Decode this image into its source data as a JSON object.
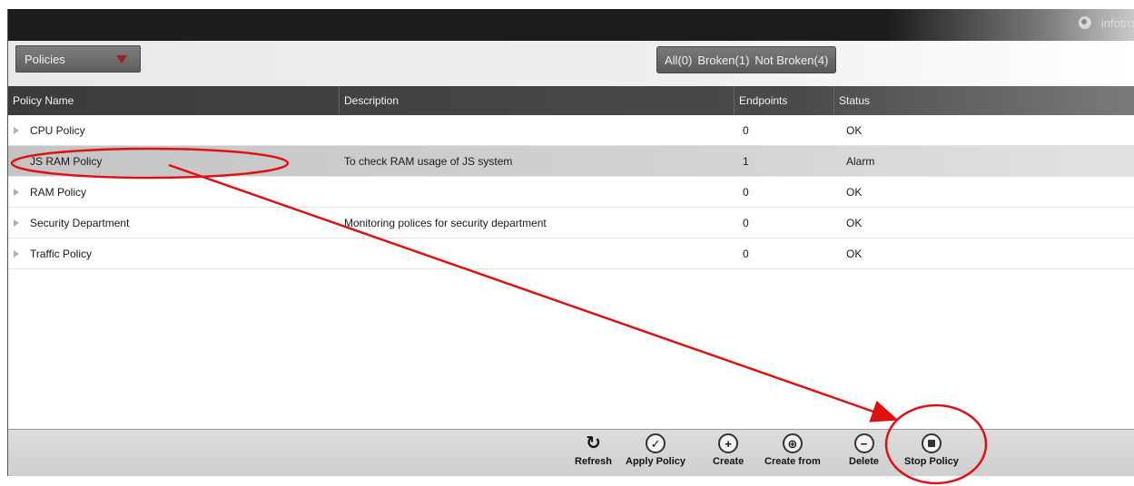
{
  "topbar": {
    "user_label": "infotro"
  },
  "toolbar": {
    "policies_dropdown": "Policies",
    "filters": [
      "All(0)",
      "Broken(1)",
      "Not Broken(4)"
    ]
  },
  "table": {
    "headers": {
      "name": "Policy Name",
      "description": "Description",
      "endpoints": "Endpoints",
      "status": "Status"
    },
    "rows": [
      {
        "name": "CPU Policy",
        "description": "",
        "endpoints": "0",
        "status": "OK"
      },
      {
        "name": "JS RAM Policy",
        "description": "To check RAM usage of JS system",
        "endpoints": "1",
        "status": "Alarm"
      },
      {
        "name": "RAM Policy",
        "description": "",
        "endpoints": "0",
        "status": "OK"
      },
      {
        "name": "Security Department",
        "description": "Monitoring polices for security department",
        "endpoints": "0",
        "status": "OK"
      },
      {
        "name": "Traffic Policy",
        "description": "",
        "endpoints": "0",
        "status": "OK"
      }
    ]
  },
  "actions": {
    "refresh": "Refresh",
    "apply_policy": "Apply Policy",
    "create": "Create",
    "create_from": "Create from",
    "delete": "Delete",
    "stop_policy": "Stop Policy"
  },
  "colors": {
    "annotation": "#e01010",
    "selected_row": "#c9c9c9"
  },
  "icons": [
    "globe-icon",
    "dropdown-caret-icon",
    "expand-triangle-icon",
    "refresh-icon",
    "check-circle-icon",
    "plus-circle-icon",
    "create-from-icon",
    "minus-circle-icon",
    "stop-circle-icon"
  ]
}
